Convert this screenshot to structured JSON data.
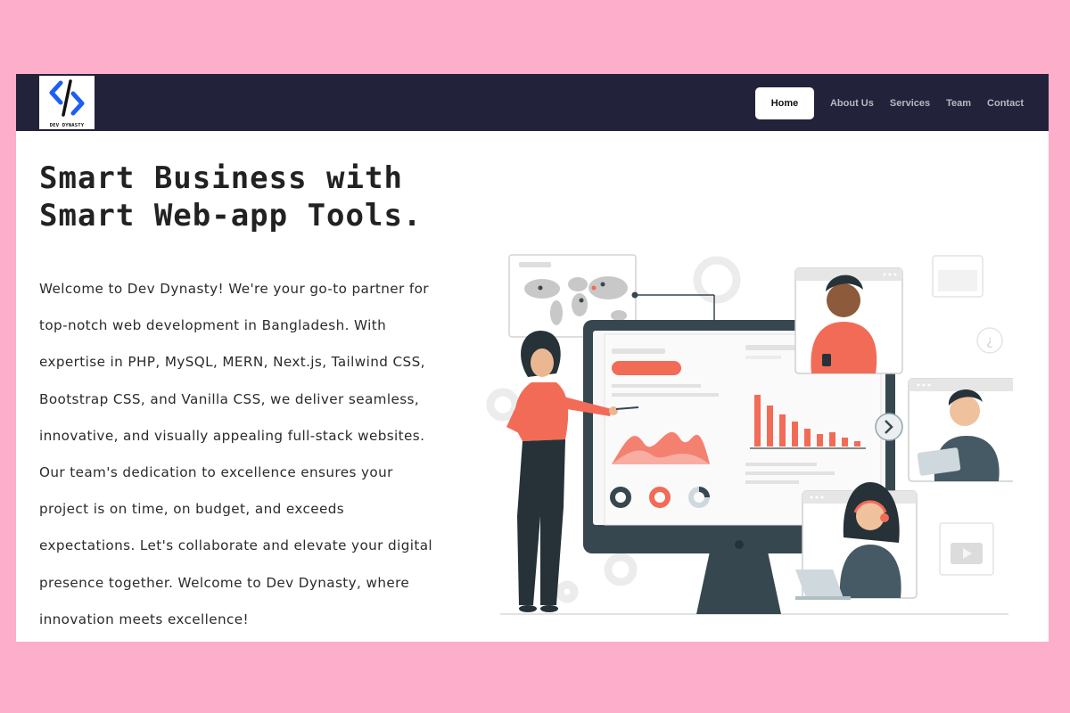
{
  "brand": {
    "logo_text": "DEV DYNASTY"
  },
  "nav": {
    "items": [
      "Home",
      "About Us",
      "Services",
      "Team",
      "Contact"
    ],
    "active_index": 0
  },
  "hero": {
    "title_line1": "Smart Business with",
    "title_line2": "Smart Web-app Tools.",
    "description": "Welcome to Dev Dynasty! We're your go-to partner for top-notch web development in Bangladesh. With expertise in PHP, MySQL, MERN, Next.js, Tailwind CSS, Bootstrap CSS, and Vanilla CSS, we deliver seamless, innovative, and visually appealing full-stack websites. Our team's dedication to excellence ensures your project is on time, on budget, and exceeds expectations. Let's collaborate and elevate your digital presence together. Welcome to Dev Dynasty, where innovation meets excellence!"
  },
  "colors": {
    "page_background": "#fdaecb",
    "navbar": "#22223a",
    "accent": "#f26b57",
    "monitor": "#37474f"
  },
  "illustration": {
    "icon": "team-presentation-illustration"
  }
}
